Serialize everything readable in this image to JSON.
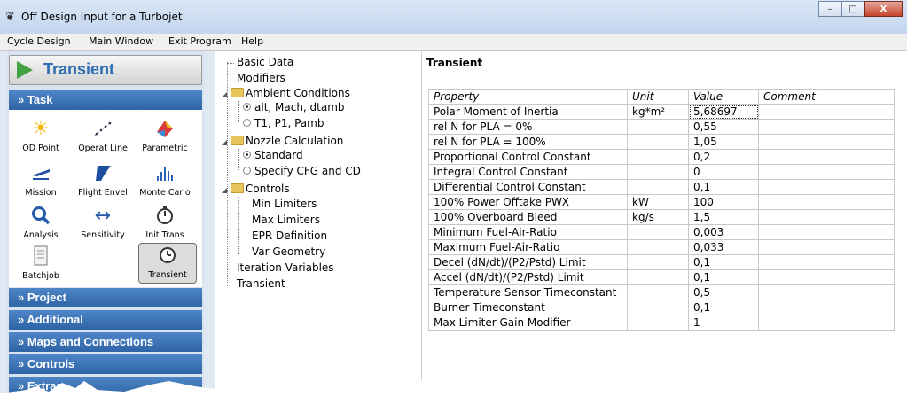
{
  "window": {
    "title": "Off Design Input for a Turbojet",
    "minimize": "–",
    "maximize": "□",
    "close": "X"
  },
  "menu": [
    "Cycle Design",
    "Main Window",
    "Exit Program",
    "Help"
  ],
  "transient_button": {
    "label": "Transient",
    "icon": "play-icon"
  },
  "sections": {
    "task": "» Task",
    "project": "» Project",
    "additional": "» Additional",
    "maps": "» Maps and Connections",
    "controls": "» Controls",
    "extras": "» Extras"
  },
  "tools": [
    {
      "label": "OD Point",
      "icon": "sun-icon"
    },
    {
      "label": "Operat Line",
      "icon": "scatter-line-icon"
    },
    {
      "label": "Parametric",
      "icon": "surface-plot-icon"
    },
    {
      "label": "Mission",
      "icon": "airplane-icon"
    },
    {
      "label": "Flight Envel",
      "icon": "envelope-shape-icon"
    },
    {
      "label": "Monte Carlo",
      "icon": "histogram-icon"
    },
    {
      "label": "Analysis",
      "icon": "magnifier-icon"
    },
    {
      "label": "Sensitivity",
      "icon": "double-arrow-icon"
    },
    {
      "label": "Init Trans",
      "icon": "stopwatch-icon"
    },
    {
      "label": "Batchjob",
      "icon": "document-icon"
    },
    {
      "label": "Transient",
      "icon": "clock-icon"
    }
  ],
  "tree": {
    "basic_data": "Basic Data",
    "modifiers": "Modifiers",
    "ambient": "Ambient Conditions",
    "ambient_opt1": "alt, Mach, dtamb",
    "ambient_opt2": "T1, P1, Pamb",
    "nozzle": "Nozzle Calculation",
    "nozzle_opt1": "Standard",
    "nozzle_opt2": "Specify CFG and CD",
    "controls": "Controls",
    "min_limiters": "Min Limiters",
    "max_limiters": "Max Limiters",
    "epr": "EPR Definition",
    "var_geometry": "Var Geometry",
    "iteration": "Iteration Variables",
    "transient": "Transient"
  },
  "panel_title": "Transient",
  "table": {
    "headers": [
      "Property",
      "Unit",
      "Value",
      "Comment"
    ],
    "rows": [
      {
        "property": "Polar Moment of Inertia",
        "unit": "kg*m²",
        "value": "5,68697",
        "comment": ""
      },
      {
        "property": "rel N for PLA = 0%",
        "unit": "",
        "value": "0,55",
        "comment": ""
      },
      {
        "property": "rel N for PLA = 100%",
        "unit": "",
        "value": "1,05",
        "comment": ""
      },
      {
        "property": "Proportional Control Constant",
        "unit": "",
        "value": "0,2",
        "comment": ""
      },
      {
        "property": "Integral    Control Constant",
        "unit": "",
        "value": "0",
        "comment": ""
      },
      {
        "property": "Differential Control Constant",
        "unit": "",
        "value": "0,1",
        "comment": ""
      },
      {
        "property": "100% Power Offtake PWX",
        "unit": "kW",
        "value": "100",
        "comment": ""
      },
      {
        "property": "100% Overboard Bleed",
        "unit": "kg/s",
        "value": "1,5",
        "comment": ""
      },
      {
        "property": "Minimum Fuel-Air-Ratio",
        "unit": "",
        "value": "0,003",
        "comment": ""
      },
      {
        "property": "Maximum Fuel-Air-Ratio",
        "unit": "",
        "value": "0,033",
        "comment": ""
      },
      {
        "property": "Decel (dN/dt)/(P2/Pstd) Limit",
        "unit": "",
        "value": "0,1",
        "comment": ""
      },
      {
        "property": "Accel (dN/dt)/(P2/Pstd) Limit",
        "unit": "",
        "value": "0,1",
        "comment": ""
      },
      {
        "property": "Temperature Sensor Timeconstant",
        "unit": "",
        "value": "0,5",
        "comment": ""
      },
      {
        "property": "Burner Timeconstant",
        "unit": "",
        "value": "0,1",
        "comment": ""
      },
      {
        "property": "Max Limiter Gain Modifier",
        "unit": "",
        "value": "1",
        "comment": ""
      }
    ]
  }
}
